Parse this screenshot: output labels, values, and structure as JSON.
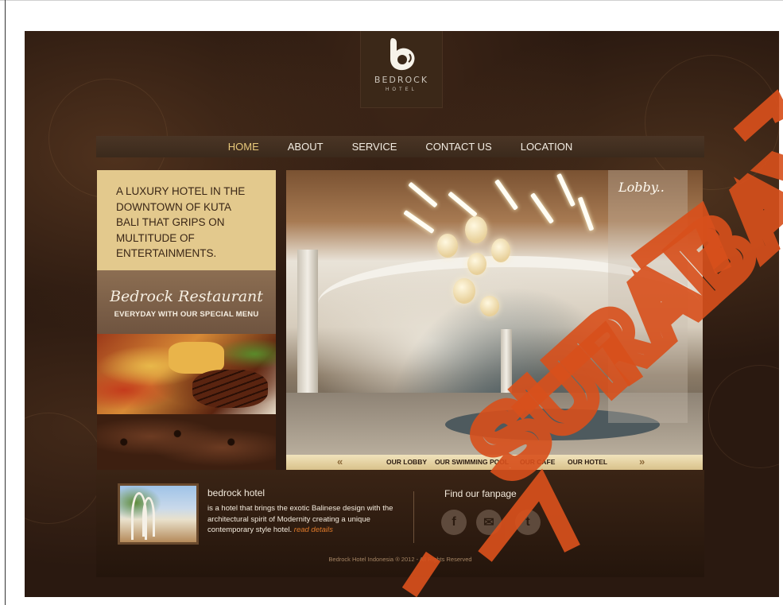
{
  "logo": {
    "name": "BEDROCK",
    "sub": "HOTEL"
  },
  "nav": [
    {
      "label": "HOME"
    },
    {
      "label": "ABOUT"
    },
    {
      "label": "SERVICE"
    },
    {
      "label": "CONTACT US"
    },
    {
      "label": "LOCATION"
    }
  ],
  "tagline": "A LUXURY HOTEL IN THE DOWNTOWN OF KUTA BALI THAT GRIPS ON MULTITUDE OF ENTERTAINMENTS.",
  "restaurant": {
    "title": "Bedrock Restaurant",
    "subtitle": "EVERYDAY WITH OUR SPECIAL MENU"
  },
  "slideshow": {
    "caption": "Lobby.."
  },
  "gallery": {
    "prev": "«",
    "next": "»",
    "links": [
      "OUR LOBBY",
      "OUR SWIMMING POOL",
      "OUR CAFE",
      "OUR HOTEL"
    ]
  },
  "footer": {
    "about_title": "bedrock hotel",
    "about_text": "is a hotel that brings the exotic Balinese design with the architectural spirit of Modernity creating a unique contemporary style hotel.",
    "read_more": "read details",
    "fanpage_title": "Find our fanpage",
    "social": [
      {
        "icon": "facebook-icon",
        "glyph": "f"
      },
      {
        "icon": "mail-icon",
        "glyph": "✉"
      },
      {
        "icon": "twitter-icon",
        "glyph": "t"
      }
    ],
    "copyright": "Bedrock Hotel Indonesia ® 2012 - All Rights Reserved"
  },
  "watermark": {
    "text": "SURABAYA",
    "color": "#d8501c"
  }
}
